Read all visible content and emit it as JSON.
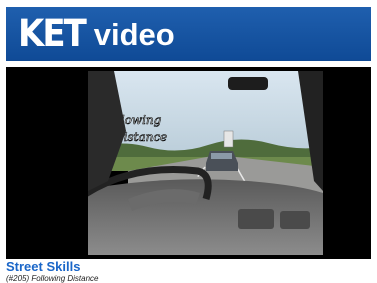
{
  "header": {
    "logo_text": "KET",
    "title": "video",
    "background": "#1a56a3"
  },
  "video": {
    "overlay_title": "Following Distance"
  },
  "program": {
    "title": "Street Skills",
    "episode": "(#205) Following Distance",
    "link_color": "#1a66c8"
  }
}
